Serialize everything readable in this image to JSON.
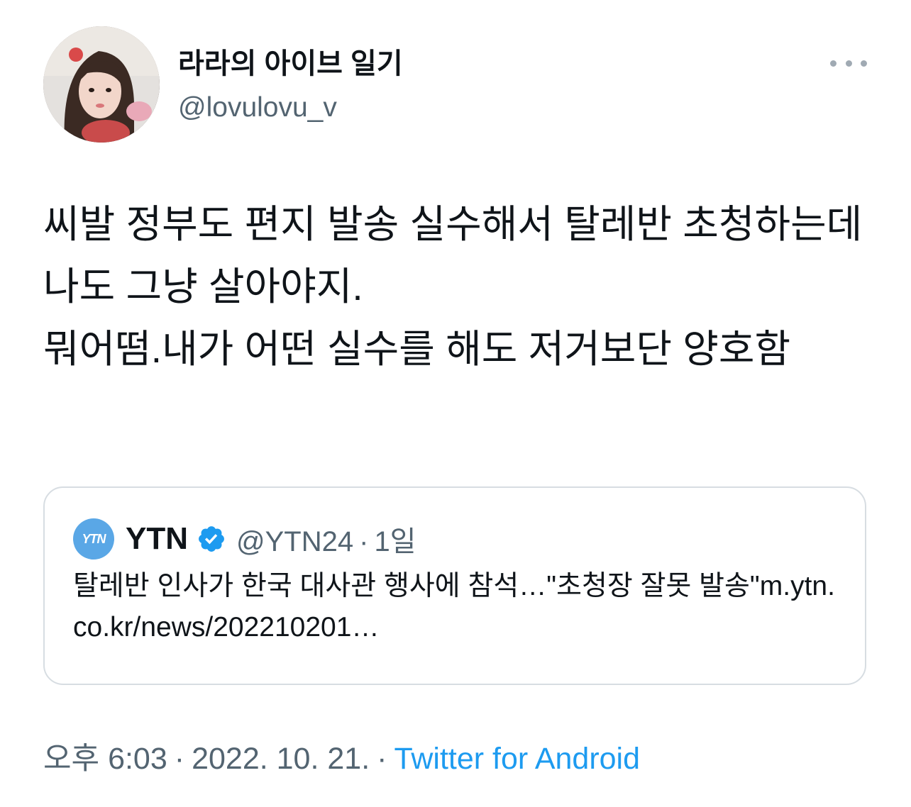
{
  "author": {
    "display_name": "라라의 아이브 일기",
    "handle": "@lovulovu_v",
    "avatar": "profile-photo"
  },
  "more_icon": "more-horizontal-icon",
  "tweet": {
    "text": "씨발 정부도 편지 발송 실수해서 탈레반 초청하는데 나도 그냥 살아야지.\n뭐어떰.내가 어떤 실수를 해도 저거보단 양호함"
  },
  "quote": {
    "avatar_text": "YTN",
    "name": "YTN",
    "verified_icon": "verified-badge-icon",
    "handle": "@YTN24",
    "separator": "·",
    "time": "1일",
    "text": "탈레반 인사가 한국 대사관 행사에 참석…\"초청장 잘못 발송\"m.ytn.co.kr/news/202210201…"
  },
  "footer": {
    "time": "오후 6:03",
    "separator": "·",
    "date": "2022. 10. 21.",
    "separator2": "·",
    "source": "Twitter for Android"
  },
  "colors": {
    "text": "#0f1419",
    "secondary": "#536471",
    "link": "#1d9bf0",
    "border": "#d7dde2",
    "ytn": "#5aa7e6"
  }
}
